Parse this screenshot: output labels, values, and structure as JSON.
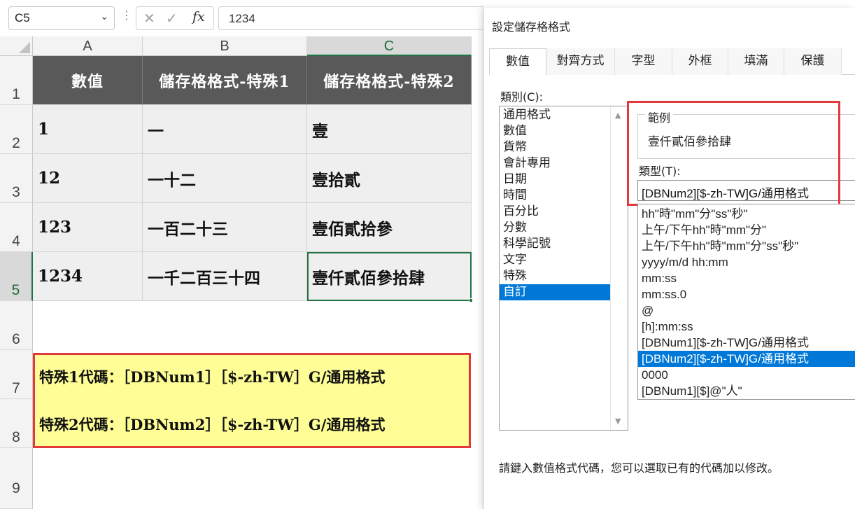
{
  "formula_bar": {
    "name_box": "C5",
    "formula": "1234",
    "cancel_glyph": "✕",
    "enter_glyph": "✓",
    "fx_label": "fx"
  },
  "sheet": {
    "columns": [
      "A",
      "B",
      "C"
    ],
    "selected_column": "C",
    "rows": [
      "1",
      "2",
      "3",
      "4",
      "5",
      "6",
      "7",
      "8",
      "9"
    ],
    "selected_row": "5",
    "active_cell": "C5",
    "header_row": [
      "數值",
      "儲存格格式-特殊1",
      "儲存格格式-特殊2"
    ],
    "data_rows": [
      [
        "1",
        "一",
        "壹"
      ],
      [
        "12",
        "一十二",
        "壹拾貳"
      ],
      [
        "123",
        "一百二十三",
        "壹佰貳拾參"
      ],
      [
        "1234",
        "一千二百三十四",
        "壹仟貳佰參拾肆"
      ]
    ],
    "notes": [
      "特殊1代碼：［DBNum1］［$-zh-TW］G/通用格式",
      "特殊2代碼：［DBNum2］［$-zh-TW］G/通用格式"
    ],
    "colors": {
      "header_bg": "#595959",
      "data_bg": "#efefef",
      "note_bg": "#fffe96",
      "highlight_border": "#e4393b",
      "selection": "#217346"
    }
  },
  "dialog": {
    "title": "設定儲存格格式",
    "tabs": [
      "數值",
      "對齊方式",
      "字型",
      "外框",
      "填滿",
      "保護"
    ],
    "active_tab": "數值",
    "category_label": "類別(C):",
    "categories": [
      "通用格式",
      "數值",
      "貨幣",
      "會計專用",
      "日期",
      "時間",
      "百分比",
      "分數",
      "科學記號",
      "文字",
      "特殊",
      "自訂"
    ],
    "selected_category": "自訂",
    "sample_label": "範例",
    "sample_value": "壹仟貳佰參拾肆",
    "type_label": "類型(T):",
    "type_value": "[DBNum2][$-zh-TW]G/通用格式",
    "format_list": [
      "hh\"時\"mm\"分\"ss\"秒\"",
      "上午/下午hh\"時\"mm\"分\"",
      "上午/下午hh\"時\"mm\"分\"ss\"秒\"",
      "yyyy/m/d hh:mm",
      "mm:ss",
      "mm:ss.0",
      "@",
      "[h]:mm:ss",
      "[DBNum1][$-zh-TW]G/通用格式",
      "[DBNum2][$-zh-TW]G/通用格式",
      "0000",
      "[DBNum1][$]@\"人\""
    ],
    "selected_format": "[DBNum2][$-zh-TW]G/通用格式",
    "hint": "請鍵入數值格式代碼，您可以選取已有的代碼加以修改。",
    "selection_color": "#0078d7"
  }
}
